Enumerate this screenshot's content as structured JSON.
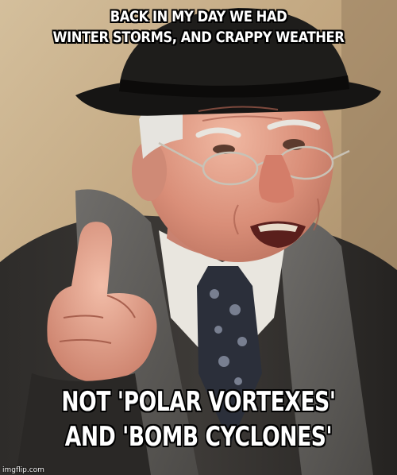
{
  "caption": {
    "top_lines": [
      "BACK IN MY DAY WE HAD",
      "WINTER STORMS, AND CRAPPY WEATHER"
    ],
    "bottom_lines": [
      "NOT 'POLAR VORTEXES'",
      "AND 'BOMB CYCLONES'"
    ]
  },
  "watermark": "imgflip.com",
  "colors": {
    "caption_text": "#ffffff",
    "caption_outline": "#000000"
  }
}
